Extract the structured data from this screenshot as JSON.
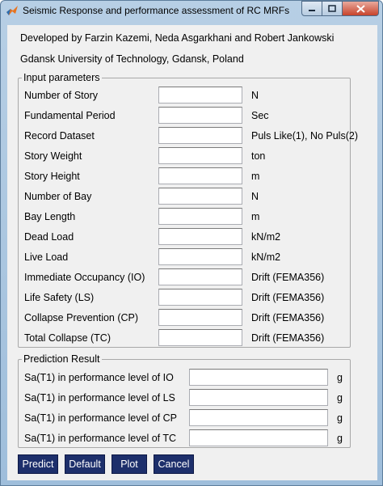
{
  "window": {
    "title": "Seismic Response and performance assessment of RC MRFs"
  },
  "credits": {
    "authors": "Developed by Farzin Kazemi, Neda Asgarkhani and Robert Jankowski",
    "affiliation": "Gdansk University of Technology, Gdansk, Poland"
  },
  "input_parameters": {
    "title": "Input parameters",
    "rows": [
      {
        "label": "Number of Story",
        "value": "",
        "unit": "N"
      },
      {
        "label": "Fundamental Period",
        "value": "",
        "unit": "Sec"
      },
      {
        "label": "Record Dataset",
        "value": "",
        "unit": "Puls Like(1), No Puls(2)"
      },
      {
        "label": "Story Weight",
        "value": "",
        "unit": "ton"
      },
      {
        "label": "Story Height",
        "value": "",
        "unit": "m"
      },
      {
        "label": "Number of Bay",
        "value": "",
        "unit": "N"
      },
      {
        "label": "Bay Length",
        "value": "",
        "unit": "m"
      },
      {
        "label": "Dead Load",
        "value": "",
        "unit": "kN/m2"
      },
      {
        "label": "Live Load",
        "value": "",
        "unit": "kN/m2"
      },
      {
        "label": "Immediate Occupancy (IO)",
        "value": "",
        "unit": "Drift (FEMA356)"
      },
      {
        "label": "Life Safety (LS)",
        "value": "",
        "unit": "Drift (FEMA356)"
      },
      {
        "label": "Collapse Prevention (CP)",
        "value": "",
        "unit": "Drift (FEMA356)"
      },
      {
        "label": "Total Collapse (TC)",
        "value": "",
        "unit": "Drift (FEMA356)"
      }
    ]
  },
  "prediction_result": {
    "title": "Prediction Result",
    "rows": [
      {
        "label": "Sa(T1) in performance level of IO",
        "value": "",
        "unit": "g"
      },
      {
        "label": "Sa(T1) in performance level of LS",
        "value": "",
        "unit": "g"
      },
      {
        "label": "Sa(T1) in performance level of CP",
        "value": "",
        "unit": "g"
      },
      {
        "label": "Sa(T1) in performance level of TC",
        "value": "",
        "unit": "g"
      }
    ]
  },
  "buttons": {
    "predict": "Predict",
    "default": "Default",
    "plot": "Plot",
    "cancel": "Cancel"
  }
}
